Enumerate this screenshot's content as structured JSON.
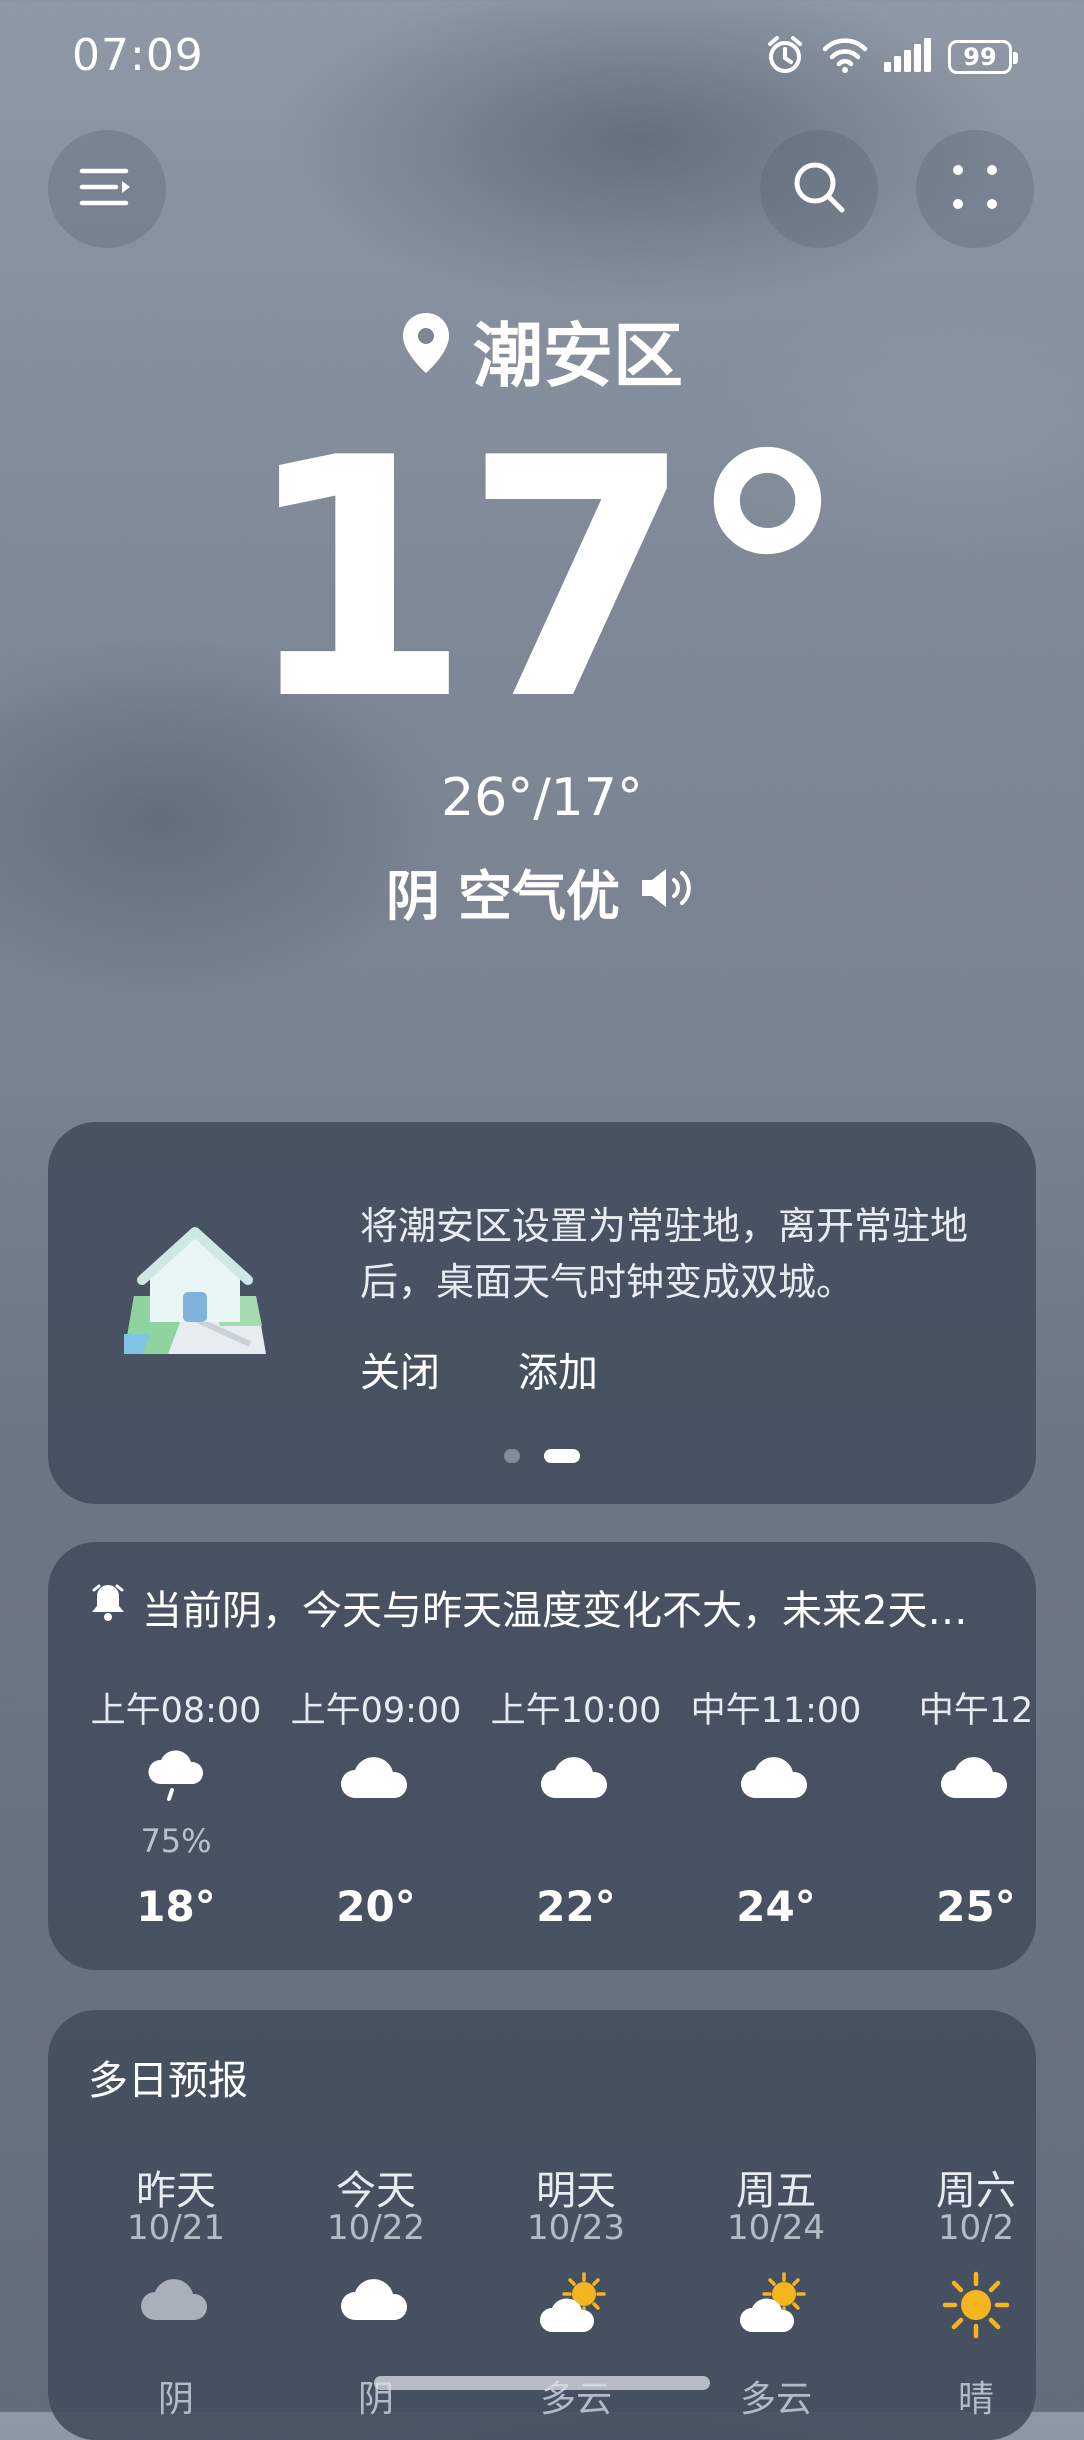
{
  "status_bar": {
    "time": "07:09",
    "battery": "99"
  },
  "location": {
    "name": "潮安区"
  },
  "current": {
    "temperature": "17°",
    "range": "26°/17°",
    "condition": "阴",
    "air_quality": "空气优"
  },
  "promo": {
    "text": "将潮安区设置为常驻地，离开常驻地后，桌面天气时钟变成双城。",
    "close_label": "关闭",
    "add_label": "添加",
    "page_count": 2,
    "active_page": 2
  },
  "hourly": {
    "alert": "当前阴，今天与昨天温度变化不大，未来2天…",
    "items": [
      {
        "time": "上午08:00",
        "icon": "cloud-rain-icon",
        "pop": "75%",
        "temp": "18°"
      },
      {
        "time": "上午09:00",
        "icon": "cloud-icon",
        "pop": "",
        "temp": "20°"
      },
      {
        "time": "上午10:00",
        "icon": "cloud-icon",
        "pop": "",
        "temp": "22°"
      },
      {
        "time": "中午11:00",
        "icon": "cloud-icon",
        "pop": "",
        "temp": "24°"
      },
      {
        "time": "中午12",
        "icon": "cloud-icon",
        "pop": "",
        "temp": "25°"
      }
    ]
  },
  "daily": {
    "title": "多日预报",
    "items": [
      {
        "name": "昨天",
        "date": "10/21",
        "icon": "cloud-grey-icon",
        "cond": "阴"
      },
      {
        "name": "今天",
        "date": "10/22",
        "icon": "cloud-icon",
        "cond": "阴"
      },
      {
        "name": "明天",
        "date": "10/23",
        "icon": "partly-sunny-icon",
        "cond": "多云"
      },
      {
        "name": "周五",
        "date": "10/24",
        "icon": "partly-sunny-icon",
        "cond": "多云"
      },
      {
        "name": "周六",
        "date": "10/2",
        "icon": "sun-icon",
        "cond": "晴"
      }
    ]
  },
  "colors": {
    "card": "#424c5c",
    "sun": "#f5b51e",
    "text_muted": "#b3bbc5"
  }
}
